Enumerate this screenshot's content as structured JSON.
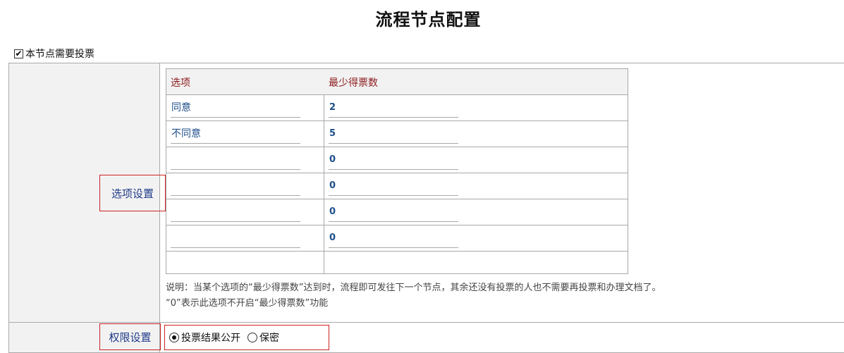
{
  "page": {
    "title": "流程节点配置"
  },
  "vote_required": {
    "label": "本节点需要投票",
    "checked": true
  },
  "options_section": {
    "label": "选项设置",
    "table": {
      "headers": [
        "选项",
        "最少得票数"
      ],
      "rows": [
        {
          "option": "同意",
          "min_votes": "2"
        },
        {
          "option": "不同意",
          "min_votes": "5"
        },
        {
          "option": "",
          "min_votes": "0"
        },
        {
          "option": "",
          "min_votes": "0"
        },
        {
          "option": "",
          "min_votes": "0"
        },
        {
          "option": "",
          "min_votes": "0"
        }
      ]
    },
    "note_line1": "说明：当某个选项的“最少得票数”达到时，流程即可发往下一个节点，其余还没有投票的人也不需要再投票和办理文档了。",
    "note_line2": "“0”表示此选项不开启“最少得票数”功能"
  },
  "permission_section": {
    "label": "权限设置",
    "options": [
      {
        "label": "投票结果公开",
        "selected": true
      },
      {
        "label": "保密",
        "selected": false
      }
    ]
  }
}
